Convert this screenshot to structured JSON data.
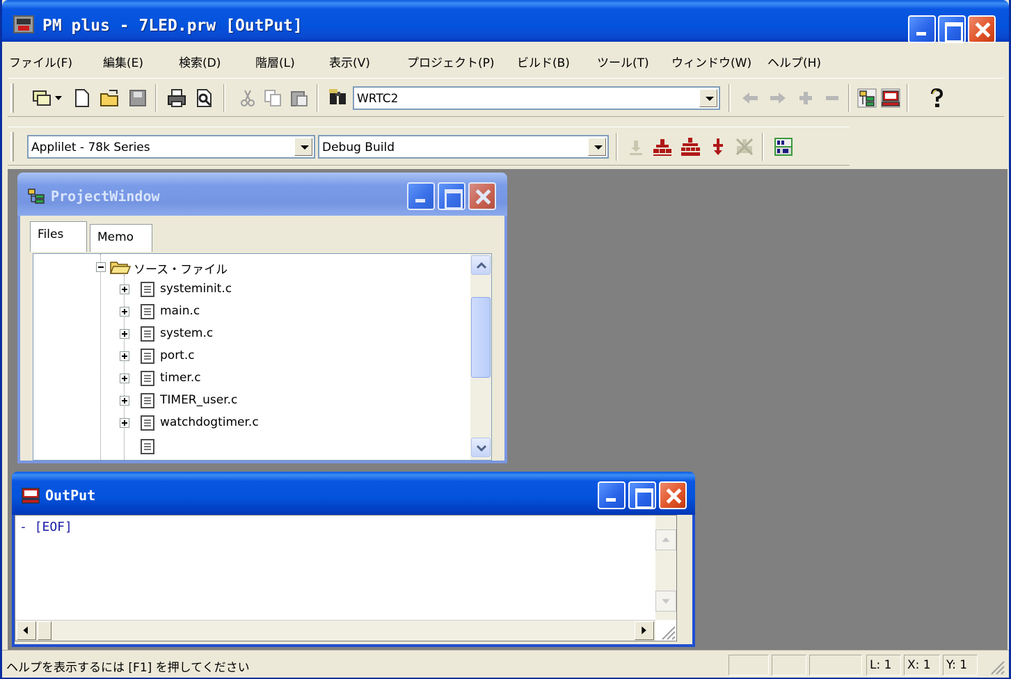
{
  "window": {
    "title": "PM plus - 7LED.prw [OutPut]"
  },
  "menu": [
    "ファイル(F)",
    "編集(E)",
    "検索(D)",
    "階層(L)",
    "表示(V)",
    "プロジェクト(P)",
    "ビルド(B)",
    "ツール(T)",
    "ウィンドウ(W)",
    "ヘルプ(H)"
  ],
  "toolbar1": {
    "project_combo_value": "WRTC2"
  },
  "toolbar2": {
    "applilet_combo_value": "Applilet - 78k Series",
    "build_combo_value": "Debug Build"
  },
  "project_window": {
    "title": "ProjectWindow",
    "tabs": [
      "Files",
      "Memo"
    ],
    "folder": "ソース・ファイル",
    "files": [
      "systeminit.c",
      "main.c",
      "system.c",
      "port.c",
      "timer.c",
      "TIMER_user.c",
      "watchdogtimer.c"
    ]
  },
  "output_window": {
    "title": "OutPut",
    "text": "- [EOF]"
  },
  "statusbar": {
    "help_text": "ヘルプを表示するには [F1] を押してください",
    "line": "L: 1",
    "col": "X: 1",
    "row": "Y: 1"
  },
  "colors": {
    "titlebar_blue": "#0453dc",
    "close_red": "#e2562b",
    "mdi_gray": "#808080",
    "output_text": "#1c1ca8"
  }
}
